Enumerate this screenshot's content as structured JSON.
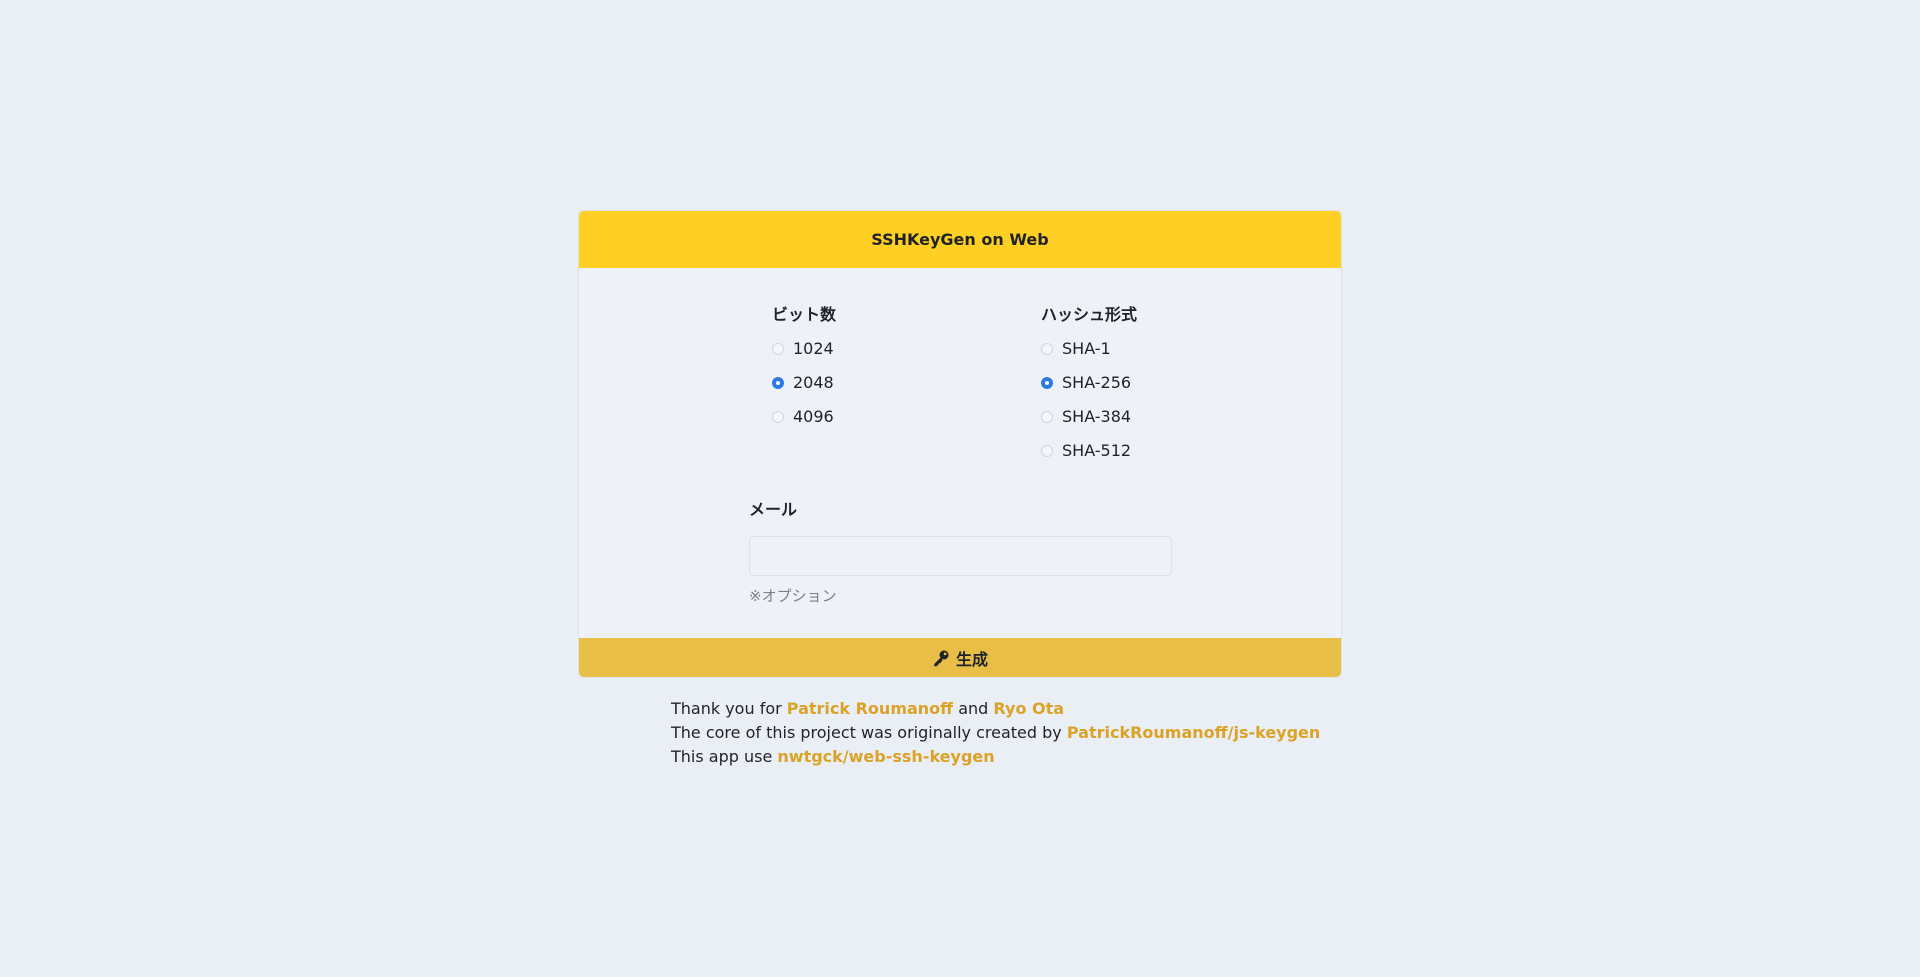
{
  "header": {
    "title": "SSHKeyGen on Web"
  },
  "bits": {
    "title": "ビット数",
    "options": [
      {
        "label": "1024",
        "checked": false
      },
      {
        "label": "2048",
        "checked": true
      },
      {
        "label": "4096",
        "checked": false
      }
    ]
  },
  "hash": {
    "title": "ハッシュ形式",
    "options": [
      {
        "label": "SHA-1",
        "checked": false
      },
      {
        "label": "SHA-256",
        "checked": true
      },
      {
        "label": "SHA-384",
        "checked": false
      },
      {
        "label": "SHA-512",
        "checked": false
      }
    ]
  },
  "email": {
    "title": "メール",
    "value": "",
    "placeholder": "",
    "hint": "※オプション"
  },
  "generate": {
    "label": "生成",
    "icon": "key-icon"
  },
  "footer": {
    "line1": {
      "prefix": "Thank you for",
      "link1": "Patrick Roumanoff",
      "mid": "and",
      "link2": "Ryo Ota"
    },
    "line2": {
      "prefix": "The core of this project was originally created by",
      "link": "PatrickRoumanoff/js-keygen"
    },
    "line3": {
      "prefix": "This app use",
      "link": "nwtgck/web-ssh-keygen"
    }
  },
  "colors": {
    "header": "#ffcf24",
    "button": "#e9be47",
    "link": "#dca225",
    "radio_checked": "#2c7be5",
    "background": "#eaeff6"
  }
}
